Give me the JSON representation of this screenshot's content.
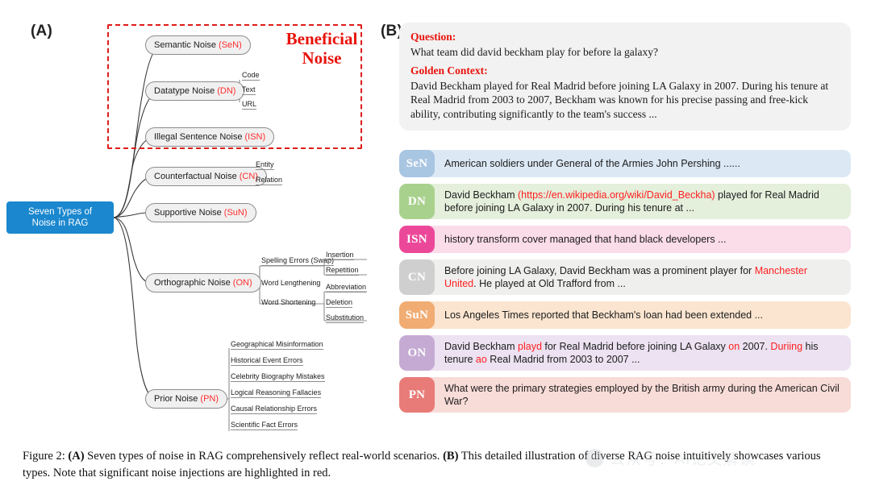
{
  "panels": {
    "a_label": "(A)",
    "b_label": "(B)"
  },
  "mindmap": {
    "root": "Seven Types of\nNoise in RAG",
    "root_color": "#1a87ce",
    "highlight_box": {
      "title": "Beneficial\nNoise",
      "color": "#e8120b",
      "style": "dash-dot"
    },
    "nodes": [
      {
        "label": "Semantic Noise",
        "abbr": "(SeN)"
      },
      {
        "label": "Datatype Noise",
        "abbr": "(DN)"
      },
      {
        "label": "Illegal Sentence Noise",
        "abbr": "(ISN)"
      },
      {
        "label": "Counterfactual Noise",
        "abbr": "(CN)"
      },
      {
        "label": "Supportive Noise",
        "abbr": "(SuN)"
      },
      {
        "label": "Orthographic Noise",
        "abbr": "(ON)"
      },
      {
        "label": "Prior Noise",
        "abbr": "(PN)"
      }
    ],
    "datatype_children": [
      "Code",
      "Text",
      "URL"
    ],
    "counterfactual_children": [
      "Entity",
      "Relation"
    ],
    "orthographic_children": {
      "spelling": "Spelling Errors (Swap)",
      "lengthening": "Word Lengthening",
      "lengthening_children": [
        "Insertion",
        "Repetition"
      ],
      "shortening": "Word Shortening",
      "shortening_children": [
        "Abbreviation",
        "Deletion",
        "Substitution"
      ]
    },
    "prior_children": [
      "Geographical Misinformation",
      "Historical Event Errors",
      "Celebrity Biography Mistakes",
      "Logical Reasoning Fallacies",
      "Causal Relationship Errors",
      "Scientific Fact Errors"
    ]
  },
  "qa": {
    "question_label": "Question:",
    "question_text": "What team did david beckham play for before la galaxy?",
    "context_label": "Golden Context:",
    "context_text": "David Beckham played for Real Madrid before joining LA Galaxy in 2007. During his tenure at Real Madrid from 2003 to 2007, Beckham was known for his precise passing and free-kick ability, contributing significantly to the team's success ..."
  },
  "noise_rows": [
    {
      "badge": "SeN",
      "badge_color": "#a8c5e2",
      "row_color": "#dce9f5",
      "parts": [
        {
          "t": "American soldiers under General of the Armies John Pershing ......",
          "hl": false
        }
      ]
    },
    {
      "badge": "DN",
      "badge_color": "#a9d18e",
      "row_color": "#e4efdc",
      "parts": [
        {
          "t": "David Beckham ",
          "hl": false
        },
        {
          "t": "(https://en.wikipedia.org/wiki/David_Beckha)",
          "hl": true
        },
        {
          "t": " played for Real Madrid before joining LA Galaxy in 2007. During his tenure at ...",
          "hl": false
        }
      ]
    },
    {
      "badge": "ISN",
      "badge_color": "#ec4899",
      "row_color": "#fbdce9",
      "parts": [
        {
          "t": "history transform cover managed that hand black developers ...",
          "hl": false
        }
      ]
    },
    {
      "badge": "CN",
      "badge_color": "#cfcfcf",
      "row_color": "#efefee",
      "parts": [
        {
          "t": "Before joining LA Galaxy, David Beckham was a prominent player for ",
          "hl": false
        },
        {
          "t": "Manchester United",
          "hl": true
        },
        {
          "t": ". He played at Old Trafford from ...",
          "hl": false
        }
      ]
    },
    {
      "badge": "SuN",
      "badge_color": "#f0ac72",
      "row_color": "#fbe5d0",
      "parts": [
        {
          "t": "Los Angeles Times reported that Beckham's loan had been extended ...",
          "hl": false
        }
      ]
    },
    {
      "badge": "ON",
      "badge_color": "#c5abd3",
      "row_color": "#ece2f1",
      "parts": [
        {
          "t": "David Beckham ",
          "hl": false
        },
        {
          "t": "playd",
          "hl": true
        },
        {
          "t": " for Real Madrid before joining LA Galaxy ",
          "hl": false
        },
        {
          "t": "on",
          "hl": true
        },
        {
          "t": " 2007. ",
          "hl": false
        },
        {
          "t": "Duriing",
          "hl": true
        },
        {
          "t": " his tenure ",
          "hl": false
        },
        {
          "t": "ao",
          "hl": true
        },
        {
          "t": " Real Madrid from 2003 to 2007 ...",
          "hl": false
        }
      ]
    },
    {
      "badge": "PN",
      "badge_color": "#e87b77",
      "row_color": "#f8dcd8",
      "parts": [
        {
          "t": "What were the primary strategies employed by the British army during the American Civil War?",
          "hl": false
        }
      ]
    }
  ],
  "caption": {
    "prefix": "Figure 2: ",
    "a_tag": "(A)",
    "a_text": " Seven types of noise in RAG comprehensively reflect real-world scenarios. ",
    "b_tag": "(B)",
    "b_text": " This detailed illustration of diverse RAG noise intuitively showcases various types. Note that significant noise injections are highlighted in red."
  },
  "watermark": {
    "text": "公众号：AI论文解读"
  }
}
